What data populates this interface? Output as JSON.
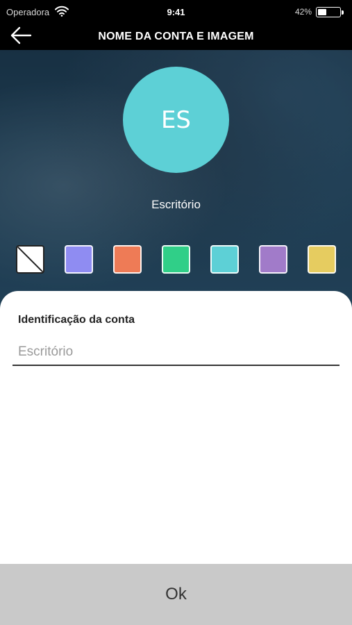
{
  "status_bar": {
    "carrier": "Operadora",
    "time": "9:41",
    "battery_text": "42%",
    "battery_level": 0.42
  },
  "header": {
    "title": "NOME DA CONTA E IMAGEM",
    "back_icon": "arrow-left-icon"
  },
  "profile": {
    "initials": "ES",
    "avatar_color": "#5dd0d6",
    "name": "Escritório"
  },
  "swatches": [
    {
      "name": "none",
      "color": "none"
    },
    {
      "name": "periwinkle",
      "color": "#8f8cf2"
    },
    {
      "name": "orange",
      "color": "#ee7b56"
    },
    {
      "name": "green",
      "color": "#30cf88"
    },
    {
      "name": "cyan",
      "color": "#5dd0d6"
    },
    {
      "name": "purple",
      "color": "#a17bc9"
    },
    {
      "name": "yellow",
      "color": "#e6cc60"
    }
  ],
  "form": {
    "label": "Identificação da conta",
    "placeholder": "Escritório",
    "value": ""
  },
  "footer": {
    "ok_label": "Ok"
  }
}
